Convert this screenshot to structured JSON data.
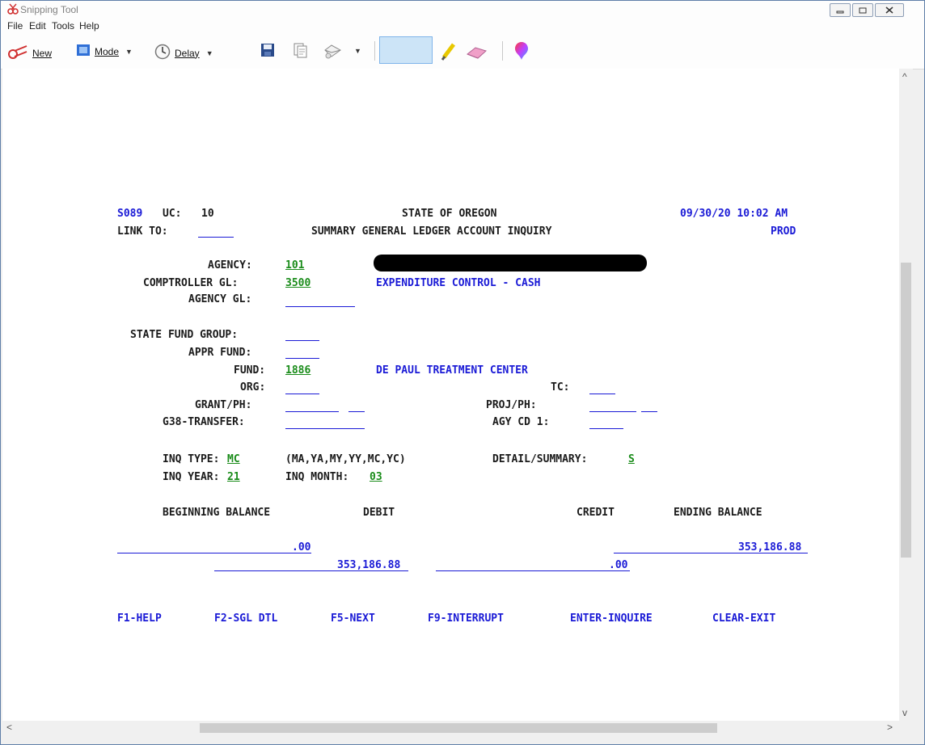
{
  "window": {
    "title": "Snipping Tool"
  },
  "menu": [
    "File",
    "Edit",
    "Tools",
    "Help"
  ],
  "toolbar": {
    "new_label": "New",
    "mode_label": "Mode",
    "delay_label": "Delay"
  },
  "terminal": {
    "screen_id": "S089",
    "uc_label": "UC:",
    "uc_value": "10",
    "state_title": "STATE OF OREGON",
    "datetime": "09/30/20 10:02 AM",
    "link_to_label": "LINK TO:",
    "screen_title": "SUMMARY GENERAL LEDGER ACCOUNT INQUIRY",
    "environment": "PROD",
    "agency_label": "AGENCY:",
    "agency_value": "101",
    "comptroller_gl_label": "COMPTROLLER GL:",
    "comptroller_gl_value": "3500",
    "comptroller_gl_desc": "EXPENDITURE CONTROL - CASH",
    "agency_gl_label": "AGENCY GL:",
    "state_fund_group_label": "STATE FUND GROUP:",
    "appr_fund_label": "APPR FUND:",
    "fund_label": "FUND:",
    "fund_value": "1886",
    "fund_desc": "DE PAUL TREATMENT CENTER",
    "org_label": "ORG:",
    "tc_label": "TC:",
    "grant_ph_label": "GRANT/PH:",
    "proj_ph_label": "PROJ/PH:",
    "g38_transfer_label": "G38-TRANSFER:",
    "agy_cd1_label": "AGY CD 1:",
    "inq_type_label": "INQ TYPE:",
    "inq_type_value": "MC",
    "inq_type_options": "(MA,YA,MY,YY,MC,YC)",
    "detail_summary_label": "DETAIL/SUMMARY:",
    "detail_summary_value": "S",
    "inq_year_label": "INQ YEAR:",
    "inq_year_value": "21",
    "inq_month_label": "INQ MONTH:",
    "inq_month_value": "03",
    "balance_headers": [
      "BEGINNING BALANCE",
      "DEBIT",
      "CREDIT",
      "ENDING BALANCE"
    ],
    "beginning_balance": ".00",
    "ending_balance": "353,186.88",
    "debit": "353,186.88",
    "credit": ".00",
    "function_keys": [
      "F1-HELP",
      "F2-SGL DTL",
      "F5-NEXT",
      "F9-INTERRUPT",
      "ENTER-INQUIRE",
      "CLEAR-EXIT"
    ]
  }
}
